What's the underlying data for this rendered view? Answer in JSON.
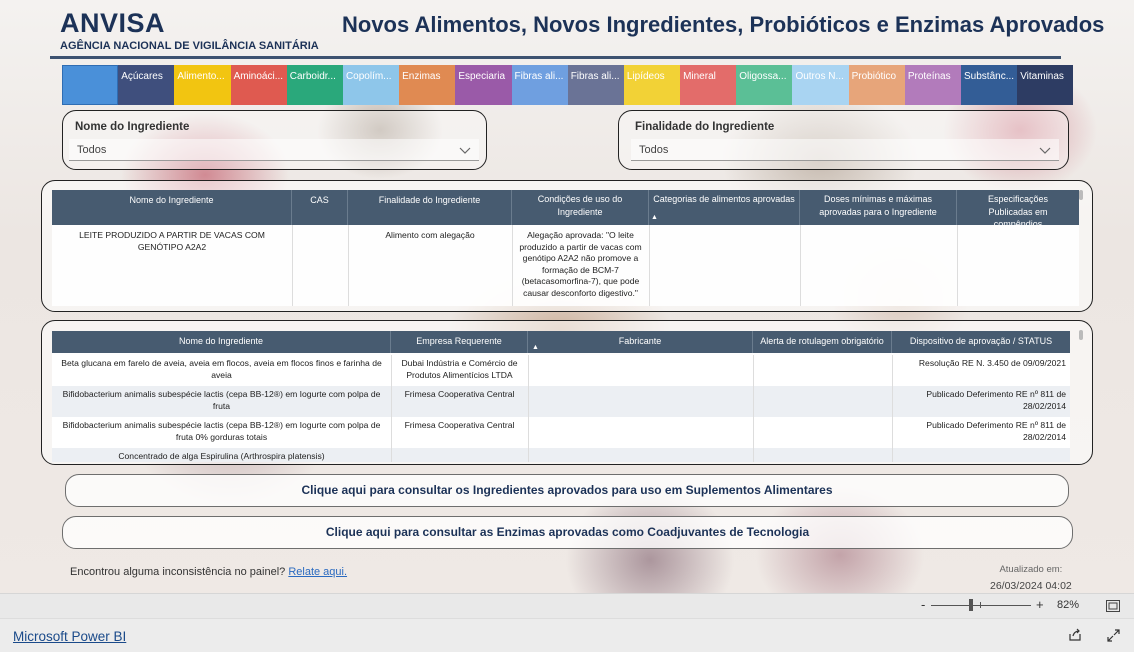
{
  "header": {
    "brand": "ANVISA",
    "brand_sub": "AGÊNCIA NACIONAL DE VIGILÂNCIA SANITÁRIA",
    "title": "Novos Alimentos, Novos Ingredientes, Probióticos e Enzimas Aprovados"
  },
  "tabs": [
    {
      "label": "",
      "color": "#4a90d9"
    },
    {
      "label": "Açúcares",
      "color": "#3f4f7d"
    },
    {
      "label": "Alimento...",
      "color": "#f2c511"
    },
    {
      "label": "Aminoáci...",
      "color": "#df5a50"
    },
    {
      "label": "Carboidr...",
      "color": "#2aa87b"
    },
    {
      "label": "Copolím...",
      "color": "#8ec6ea"
    },
    {
      "label": "Enzimas",
      "color": "#e08a52"
    },
    {
      "label": "Especiaria",
      "color": "#9a5aa8"
    },
    {
      "label": "Fibras ali...",
      "color": "#6f9fe0"
    },
    {
      "label": "Fibras ali...",
      "color": "#6a7396"
    },
    {
      "label": "Lipídeos",
      "color": "#f2d236"
    },
    {
      "label": "Mineral",
      "color": "#e36c6a"
    },
    {
      "label": "Oligossa...",
      "color": "#5bbf96"
    },
    {
      "label": "Outros N...",
      "color": "#a9d4f2"
    },
    {
      "label": "Probiótico",
      "color": "#e7a57a"
    },
    {
      "label": "Proteínas",
      "color": "#b27bbb"
    },
    {
      "label": "Substânc...",
      "color": "#335d96"
    },
    {
      "label": "Vitaminas",
      "color": "#2d3c63"
    }
  ],
  "filters": {
    "ingredient_label": "Nome do Ingrediente",
    "ingredient_value": "Todos",
    "purpose_label": "Finalidade do Ingrediente",
    "purpose_value": "Todos"
  },
  "table1": {
    "headers": [
      "Nome do Ingrediente",
      "CAS",
      "Finalidade do Ingrediente",
      "Condições de uso do Ingrediente",
      "Categorias de alimentos aprovadas",
      "Doses mínimas e máximas aprovadas para o Ingrediente",
      "Especificações Publicadas em compêndios"
    ],
    "row": {
      "name": "LEITE PRODUZIDO A PARTIR DE VACAS COM GENÓTIPO A2A2",
      "cas": "",
      "purpose": "Alimento com alegação",
      "conditions": "Alegação aprovada: \"O leite produzido a partir de vacas com genótipo A2A2 não promove a formação de BCM-7 (betacasomorfina-7), que pode causar desconforto digestivo.\"",
      "categories": "",
      "doses": "",
      "specs": ""
    }
  },
  "table2": {
    "headers": [
      "Nome do Ingrediente",
      "Empresa Requerente",
      "Fabricante",
      "Alerta de rotulagem obrigatório",
      "Dispositivo de aprovação / STATUS"
    ],
    "rows": [
      {
        "name": "Beta glucana em farelo de aveia, aveia em flocos, aveia em flocos finos e farinha de aveia",
        "company": "Dubai Indústria e Comércio de Produtos Alimentícios LTDA",
        "maker": "",
        "alert": "",
        "status": "Resolução RE N. 3.450 de 09/09/2021"
      },
      {
        "name": "Bifidobacterium animalis subespécie lactis (cepa BB-12®) em Iogurte com polpa de fruta",
        "company": "Frimesa Cooperativa Central",
        "maker": "",
        "alert": "",
        "status": "Publicado Deferimento RE nº 811 de 28/02/2014"
      },
      {
        "name": "Bifidobacterium animalis subespécie lactis (cepa BB-12®) em Iogurte com polpa de fruta 0% gorduras totais",
        "company": "Frimesa Cooperativa Central",
        "maker": "",
        "alert": "",
        "status": "Publicado Deferimento RE nº 811 de 28/02/2014"
      },
      {
        "name": "Concentrado de alga Espirulina (Arthrospira platensis)",
        "company": "",
        "maker": "",
        "alert": "",
        "status": ""
      }
    ]
  },
  "links": {
    "supplements": "Clique aqui para consultar os Ingredientes aprovados para uso em Suplementos Alimentares",
    "enzymes": "Clique aqui para consultar as Enzimas aprovadas como Coadjuvantes de Tecnologia"
  },
  "footer": {
    "question": "Encontrou alguma inconsistência no painel?",
    "report": "Relate aqui.",
    "updated_label": "Atualizado em:",
    "updated_value": "26/03/2024 04:02"
  },
  "statusbar": {
    "zoom_minus": "-",
    "zoom_plus": "+",
    "zoom": "82%",
    "zoom_level_percent": 40
  },
  "bottombar": {
    "product": "Microsoft Power BI"
  }
}
